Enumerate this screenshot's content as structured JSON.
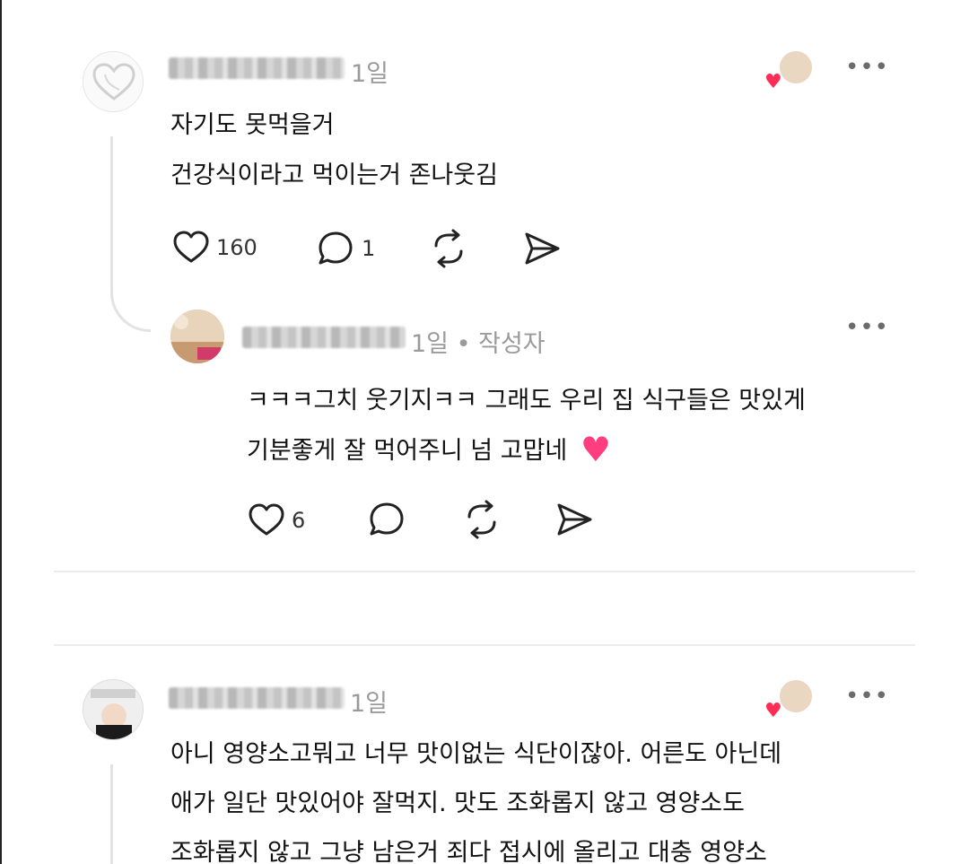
{
  "comments": [
    {
      "time": "1일",
      "lines": [
        "자기도 못먹을거",
        "건강식이라고 먹이는거 존나웃김"
      ],
      "likes": "160",
      "replies": "1",
      "more_label": "•••"
    },
    {
      "meta": "1일 • 작성자",
      "lines": [
        "ㅋㅋㅋ그치 웃기지ㅋㅋ 그래도 우리 집 식구들은 맛있게",
        "기분좋게 잘 먹어주니 넘 고맙네"
      ],
      "emoji": "♥",
      "likes": "6",
      "more_label": "•••"
    },
    {
      "time": "1일",
      "lines": [
        "아니 영양소고뭐고 너무 맛이없는 식단이잖아. 어른도 아닌데",
        "애가 일단 맛있어야 잘먹지. 맛도 조화롭지 않고 영양소도",
        "조화롭지 않고 그냥 남은거 죄다 접시에 올리고 대충 영양소"
      ],
      "more_label": "•••"
    }
  ],
  "icons": {
    "like": "heart-outline-icon",
    "reply": "speech-bubble-icon",
    "repost": "repost-icon",
    "share": "send-icon",
    "liked_by_heart": "♥"
  },
  "colors": {
    "heart_red": "#ff2d55",
    "meta_gray": "#9a9a9a",
    "thread_line": "#e3e3e3"
  }
}
